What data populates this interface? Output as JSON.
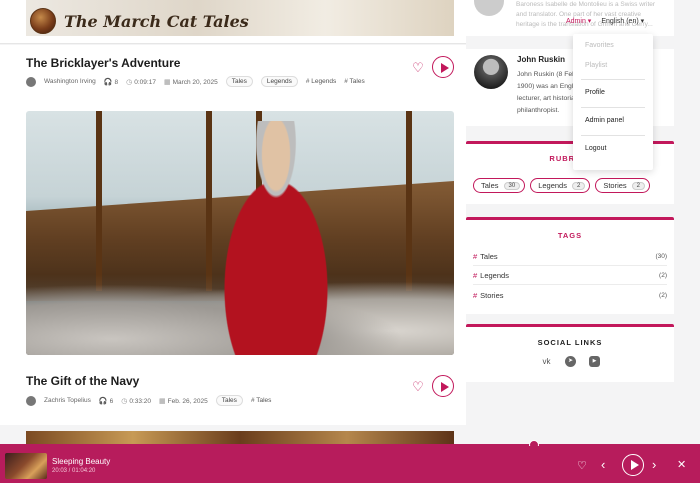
{
  "site": {
    "title": "The March Cat Tales"
  },
  "nav": {
    "admin_label": "Admin ▾",
    "language_label": "English (en) ▾"
  },
  "dropdown": {
    "items": [
      "Favorites",
      "Playlist",
      "Profile",
      "Admin panel",
      "Logout"
    ],
    "disabled": [
      "Favorites",
      "Playlist"
    ]
  },
  "posts": [
    {
      "title": "The Bricklayer's Adventure",
      "author": "Washington Irving",
      "listens": "8",
      "duration": "0:09:17",
      "date": "March 20, 2025",
      "rubrics": [
        "Tales",
        "Legends"
      ],
      "tags": [
        "# Legends",
        "# Tales"
      ]
    },
    {
      "title": "The Gift of the Navy",
      "author": "Zachris Topelius",
      "listens": "6",
      "duration": "0:33:20",
      "date": "Feb. 26, 2025",
      "rubrics": [
        "Tales"
      ],
      "tags": [
        "# Tales"
      ]
    }
  ],
  "sidebar": {
    "prev_author_bio": "Baroness Isabelle de Montolieu is a Swiss writer and translator. One part of her vast creative heritage is the translation of Grimm and Gerry...",
    "author": {
      "name": "John Ruskin",
      "bio": "John Ruskin (8 February 1819 – 20 January 1900) was an English writer, art historian, lecturer, art historian, social thinker and philanthropist."
    },
    "rubrics": {
      "title": "RUBRICS",
      "items": [
        {
          "label": "Tales",
          "count": "30"
        },
        {
          "label": "Legends",
          "count": "2"
        },
        {
          "label": "Stories",
          "count": "2"
        }
      ]
    },
    "tags": {
      "title": "TAGS",
      "items": [
        {
          "label": "Tales",
          "count": "(30)"
        },
        {
          "label": "Legends",
          "count": "(2)"
        },
        {
          "label": "Stories",
          "count": "(2)"
        }
      ]
    },
    "social": {
      "title": "SOCIAL LINKS",
      "icons": [
        "vk-icon",
        "telegram-icon",
        "youtube-icon"
      ]
    }
  },
  "player": {
    "title": "Sleeping Beauty",
    "time": "20:03 / 01:04:20",
    "progress": 0.311
  }
}
